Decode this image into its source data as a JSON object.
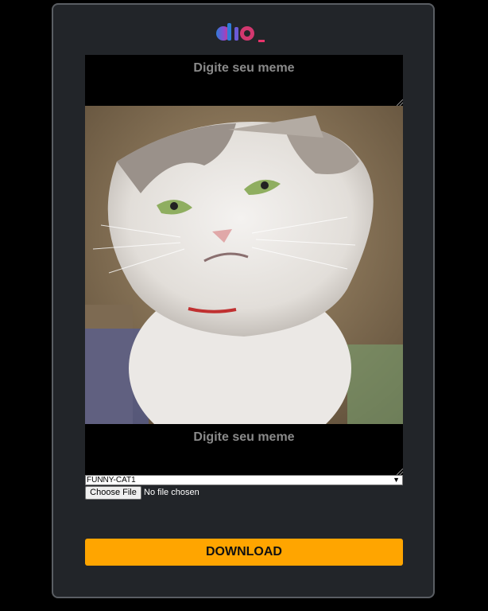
{
  "meme": {
    "top_placeholder": "Digite seu meme",
    "bottom_placeholder": "Digite seu meme"
  },
  "template_select": {
    "selected": "FUNNY-CAT1"
  },
  "file_input": {
    "button_label": "Choose File",
    "status": "No file chosen"
  },
  "download_button": {
    "label": "DOWNLOAD"
  },
  "colors": {
    "card_background": "#222529",
    "card_border": "#5a5e63",
    "download_button": "#ffa500",
    "logo_blue": "#2f6fd6",
    "logo_pink": "#e8336a"
  }
}
